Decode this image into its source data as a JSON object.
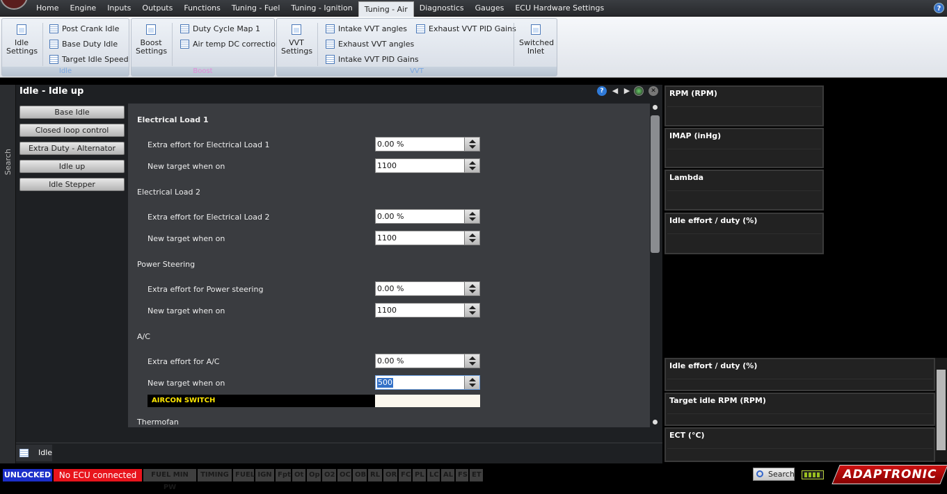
{
  "menu": {
    "tabs": [
      "Home",
      "Engine",
      "Inputs",
      "Outputs",
      "Functions",
      "Tuning - Fuel",
      "Tuning - Ignition",
      "Tuning - Air",
      "Diagnostics",
      "Gauges",
      "ECU Hardware Settings"
    ],
    "active_tab": "Tuning - Air",
    "help": "?"
  },
  "ribbon": {
    "idle": {
      "label": "Idle",
      "settings": "Idle Settings",
      "items": [
        "Post Crank Idle",
        "Base Duty Idle",
        "Target Idle Speed"
      ]
    },
    "boost": {
      "label": "Boost",
      "settings": "Boost Settings",
      "items": [
        "Duty Cycle Map 1",
        "Air temp DC correction"
      ]
    },
    "vvt": {
      "label": "VVT",
      "settings": "VVT Settings",
      "items": [
        "Intake VVT angles",
        "Exhaust VVT angles",
        "Intake VVT PID Gains",
        "Exhaust VVT PID Gains"
      ],
      "switched": "Switched Inlet"
    },
    "colors": {
      "idle": "#7aa6e0",
      "boost": "#e08ad8",
      "vvt": "#7aa6e0"
    }
  },
  "sidebar": {
    "search": "Search"
  },
  "panel": {
    "title": "Idle - Idle up",
    "nav": [
      "Base Idle",
      "Closed loop control",
      "Extra Duty - Alternator",
      "Idle up",
      "Idle Stepper"
    ],
    "sections": [
      {
        "title": "Electrical Load 1",
        "effort_label": "Extra effort for Electrical Load 1",
        "effort_value": "0.00 %",
        "target_label": "New target when on",
        "target_value": "1100"
      },
      {
        "title": "Electrical Load 2",
        "effort_label": "Extra effort for Electrical Load 2",
        "effort_value": "0.00 %",
        "target_label": "New target when on",
        "target_value": "1100"
      },
      {
        "title": "Power Steering",
        "effort_label": "Extra effort for Power steering",
        "effort_value": "0.00 %",
        "target_label": "New target when on",
        "target_value": "1100"
      },
      {
        "title": "A/C",
        "effort_label": "Extra effort for A/C",
        "effort_value": "0.00 %",
        "target_label": "New target when on",
        "target_value": "500"
      }
    ],
    "aircon_switch": "AIRCON SWITCH",
    "next_section": "Thermofan",
    "bottom_tab": "Idle"
  },
  "gauges": {
    "top": [
      "RPM (RPM)",
      "IMAP  (inHg)",
      "Lambda",
      "Idle effort / duty (%)"
    ],
    "bottom": [
      "Idle effort / duty (%)",
      "Target idle RPM (RPM)",
      "ECT (°C)"
    ]
  },
  "status": {
    "lock": "UNLOCKED",
    "ecu": "No ECU connected",
    "flags": [
      "FUEL MIN PW",
      "TIMING",
      "FUEL",
      "IGN",
      "Fpt",
      "Ot",
      "Op",
      "O2",
      "OC",
      "OB",
      "RL",
      "OR",
      "FC",
      "PL",
      "LC",
      "AL",
      "FS",
      "ET"
    ],
    "search": "Search",
    "brand": "ADAPTRONIC",
    "colors": {
      "lock_bg": "#1c2fc9",
      "ecu_bg": "#e8141c"
    }
  }
}
